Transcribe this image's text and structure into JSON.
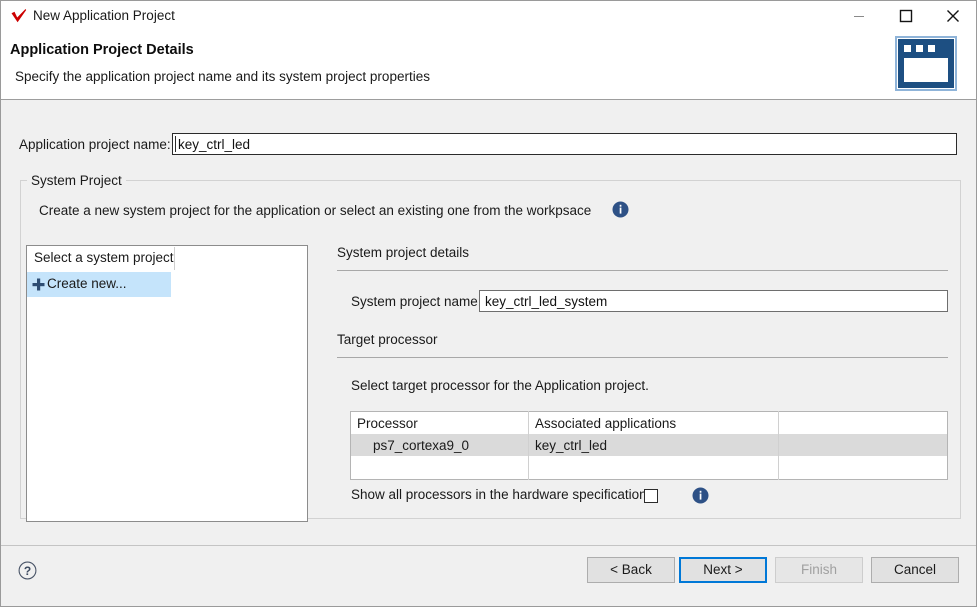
{
  "window": {
    "title": "New Application Project",
    "logo_icon": "xilinx-red-check-icon",
    "minimize_label": "—",
    "maximize_label": "□",
    "close_label": "✕"
  },
  "header": {
    "title": "Application Project Details",
    "subtitle": "Specify the application project name and its system project properties",
    "banner_icon": "wizard-window-icon"
  },
  "form": {
    "app_name_label": "Application project name:",
    "app_name_value": "key_ctrl_led",
    "app_name_placeholder": ""
  },
  "system_project_group": {
    "legend": "System Project",
    "description": "Create a new system project for the application or select an existing one from the workpsace",
    "info_icon": "info-icon",
    "list": {
      "column_header": "Select a system project",
      "items": [
        {
          "label": "Create new...",
          "icon": "plus-icon",
          "selected": true
        }
      ]
    },
    "details": {
      "section_title": "System project details",
      "name_label": "System project name:",
      "name_value": "key_ctrl_led_system",
      "name_placeholder": ""
    },
    "target_processor": {
      "section_title": "Target processor",
      "description": "Select target processor for the Application project.",
      "table": {
        "columns": [
          "Processor",
          "Associated applications",
          ""
        ],
        "rows": [
          {
            "cells": [
              "ps7_cortexa9_0",
              "key_ctrl_led",
              ""
            ],
            "selected": true
          },
          {
            "cells": [
              "",
              "",
              ""
            ],
            "selected": false
          }
        ]
      },
      "show_all_label": "Show all processors in the hardware specification",
      "show_all_checked": false,
      "show_all_info_icon": "info-icon"
    }
  },
  "footer": {
    "help_icon": "help-question-icon",
    "buttons": {
      "back": "< Back",
      "next": "Next >",
      "finish": "Finish",
      "cancel": "Cancel"
    }
  },
  "colors": {
    "accent_blue": "#0078d7",
    "info_blue": "#2e5186",
    "selection_blue": "#c5e4fb",
    "row_selection_gray": "#dadada",
    "logo_red": "#cc0000",
    "banner_navy": "#1d4f82"
  }
}
